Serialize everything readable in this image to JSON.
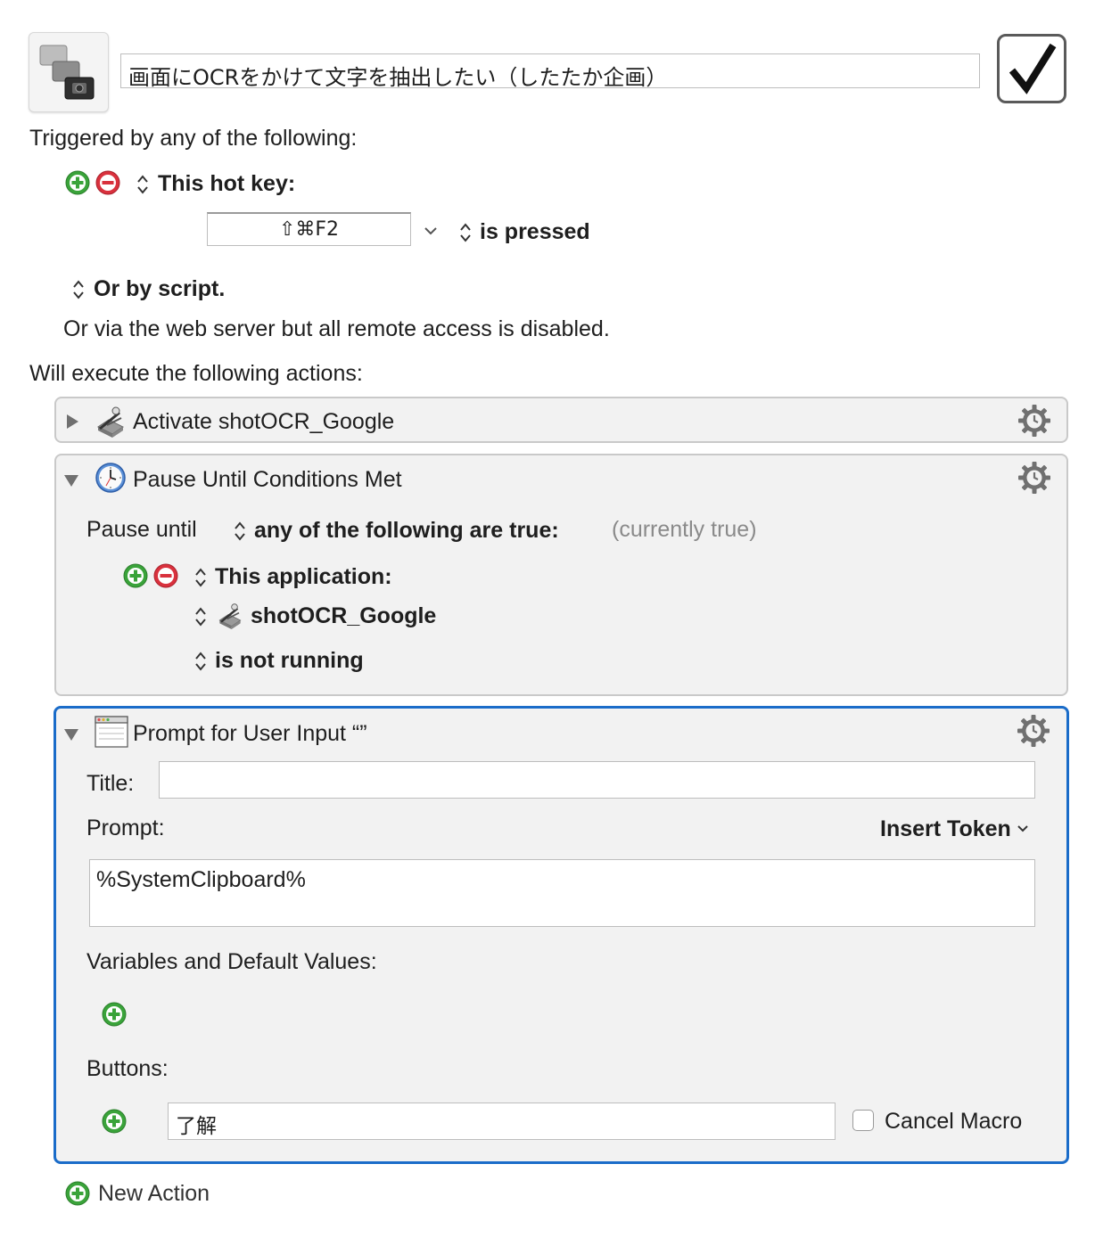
{
  "macro": {
    "name": "画面にOCRをかけて文字を抽出したい（したたか企画）",
    "enabled": true
  },
  "triggers": {
    "heading": "Triggered by any of the following:",
    "hotkey_label": "This hot key:",
    "hotkey_value": "⇧⌘F2",
    "hotkey_condition": "is pressed",
    "script_label": "Or by script.",
    "webserver_note": "Or via the web server but all remote access is disabled."
  },
  "actions": {
    "heading": "Will execute the following actions:",
    "activate": {
      "title": "Activate shotOCR_Google"
    },
    "pause": {
      "title": "Pause Until Conditions Met",
      "pause_until_label": "Pause until",
      "condition_mode": "any of the following are true:",
      "status": "(currently true)",
      "condition_type": "This application:",
      "app_name": "shotOCR_Google",
      "app_state": "is not running"
    },
    "prompt": {
      "title": "Prompt for User Input “”",
      "title_label": "Title:",
      "title_value": "",
      "prompt_label": "Prompt:",
      "insert_token": "Insert Token",
      "prompt_value": "%SystemClipboard%",
      "variables_label": "Variables and Default Values:",
      "buttons_label": "Buttons:",
      "button_value": "了解",
      "cancel_macro_label": "Cancel Macro",
      "cancel_macro_checked": false
    }
  },
  "footer": {
    "new_action": "New Action"
  },
  "colors": {
    "accent": "#1a6cc9",
    "add_green": "#3aa33a",
    "remove_red": "#d9313d"
  }
}
